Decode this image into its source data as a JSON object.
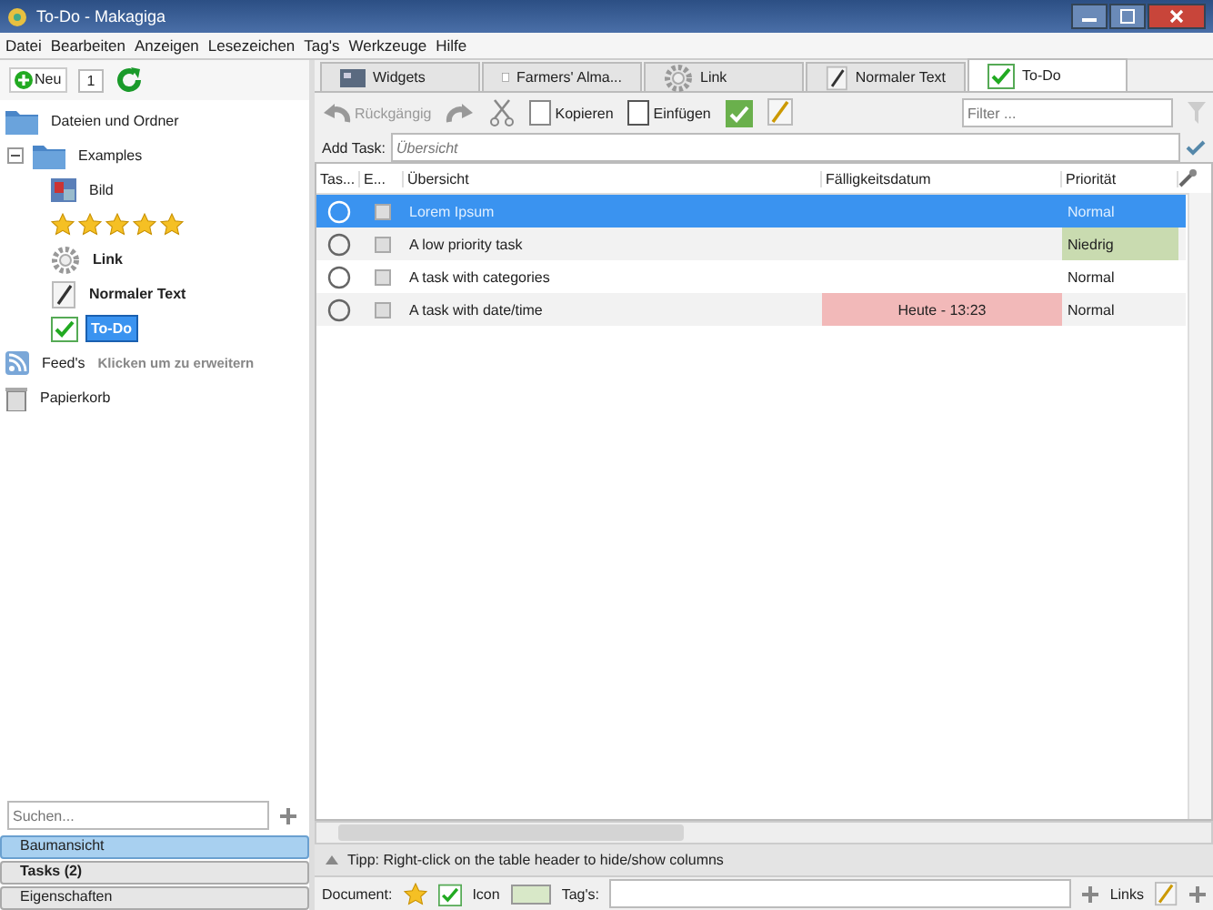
{
  "window": {
    "title": "To-Do - Makagiga"
  },
  "menu": [
    "Datei",
    "Bearbeiten",
    "Anzeigen",
    "Lesezeichen",
    "Tag's",
    "Werkzeuge",
    "Hilfe"
  ],
  "left_toolbar": {
    "new_label": "Neu",
    "counter": "1"
  },
  "tree": [
    {
      "kind": "folder",
      "label": "Dateien und Ordner",
      "selected": false,
      "bold": false
    },
    {
      "kind": "folder",
      "label": "Examples",
      "selected": false,
      "bold": false,
      "expanded": true,
      "children": [
        {
          "kind": "image",
          "label": "Bild",
          "selected": false,
          "bold": false
        },
        {
          "kind": "stars",
          "stars": 5
        },
        {
          "kind": "link",
          "label": "Link",
          "selected": false,
          "bold": true
        },
        {
          "kind": "text",
          "label": "Normaler Text",
          "selected": false,
          "bold": true
        },
        {
          "kind": "todo",
          "label": "To-Do",
          "selected": true,
          "bold": true
        }
      ]
    },
    {
      "kind": "feed",
      "label": "Feed's",
      "hint": "Klicken um zu erweitern",
      "selected": false,
      "bold": false
    },
    {
      "kind": "trash",
      "label": "Papierkorb",
      "selected": false,
      "bold": false
    }
  ],
  "search": {
    "placeholder": "Suchen..."
  },
  "panels": [
    {
      "label": "Baumansicht",
      "selected": true,
      "bold": false
    },
    {
      "label": "Tasks (2)",
      "selected": false,
      "bold": true
    },
    {
      "label": "Eigenschaften",
      "selected": false,
      "bold": false
    }
  ],
  "tabs": [
    {
      "kind": "widgets",
      "label": "Widgets",
      "selected": false
    },
    {
      "kind": "notes",
      "label": "Farmers' Alma...",
      "selected": false
    },
    {
      "kind": "link",
      "label": "Link",
      "selected": false
    },
    {
      "kind": "text",
      "label": "Normaler Text",
      "selected": false
    },
    {
      "kind": "todo",
      "label": "To-Do",
      "selected": true
    }
  ],
  "toolbar": {
    "undo": {
      "label": "Rückgängig",
      "disabled": true
    },
    "copy": "Kopieren",
    "paste": "Einfügen",
    "filter_placeholder": "Filter ..."
  },
  "add_task": {
    "label": "Add Task:",
    "placeholder": "Übersicht"
  },
  "table": {
    "columns": [
      "Tas...",
      "E...",
      "Übersicht",
      "Fälligkeitsdatum",
      "Priorität"
    ],
    "rows": [
      {
        "selected": true,
        "done": false,
        "summary": "Lorem Ipsum",
        "priority": {
          "text": "Normal"
        }
      },
      {
        "selected": false,
        "done": false,
        "summary": "A low priority task",
        "priority": {
          "text": "Niedrig",
          "color": "#c9dbb0"
        }
      },
      {
        "selected": false,
        "done": false,
        "summary": "A task with categories",
        "priority": {
          "text": "Normal"
        }
      },
      {
        "selected": false,
        "done": false,
        "summary": "A task with date/time",
        "due": {
          "text": "Heute - 13:23",
          "color": "#f2b9b9"
        },
        "priority": {
          "text": "Normal"
        }
      }
    ]
  },
  "tip": "Tipp: Right-click on the table header to hide/show columns",
  "bottom_bar": {
    "document_label": "Document:",
    "icon_label": "Icon",
    "tags_label": "Tag's:",
    "links_label": "Links"
  }
}
